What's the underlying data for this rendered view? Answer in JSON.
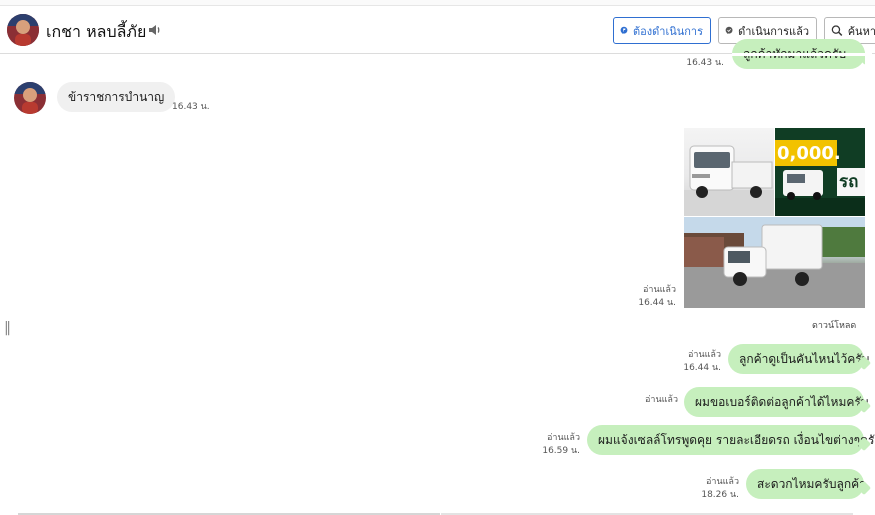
{
  "contact": {
    "name": "เกชา หลบลี้ภัย"
  },
  "header_buttons": {
    "todo_label": "ต้องดำเนินการ",
    "done_label": "ดำเนินการแล้ว",
    "search_label": "ค้นหา"
  },
  "messages": {
    "top_partial": {
      "text": "ลูกค้าทักมาแล้วครับ",
      "time": "16.43 น."
    },
    "incoming_1": {
      "text": "ข้าราชการบำนาญ",
      "time": "16.43 น."
    },
    "photo_group": {
      "read": "อ่านแล้ว",
      "time": "16.44 น.",
      "download": "ดาวน์โหลด",
      "promo_price": "0,000.",
      "promo_text": "รถ"
    },
    "out_1": {
      "read": "อ่านแล้ว",
      "time": "16.44 น.",
      "text": "ลูกค้าดูเป็นคันไหนไว้ครับ"
    },
    "out_2": {
      "read": "อ่านแล้ว",
      "text": "ผมขอเบอร์ติดต่อลูกค้าได้ไหมครับ"
    },
    "out_3": {
      "read": "อ่านแล้ว",
      "time": "16.59 น.",
      "text": "ผมแจ้งเซลล์โทรพูดคุย รายละเอียดรถ เงื่อนไขต่างๆครับ"
    },
    "out_4": {
      "read": "อ่านแล้ว",
      "time": "18.26 น.",
      "text": "สะดวกไหมครับลูกค้า"
    }
  },
  "icons": {
    "speaker": "speaker-icon",
    "todo": "chat-flag-icon",
    "done": "chat-check-icon",
    "search": "search-icon",
    "divider": "drag-handle-icon"
  },
  "colors": {
    "outgoing_bubble": "#c6efbd",
    "incoming_bubble": "#f0f0f0",
    "primary": "#2f6fd1"
  }
}
